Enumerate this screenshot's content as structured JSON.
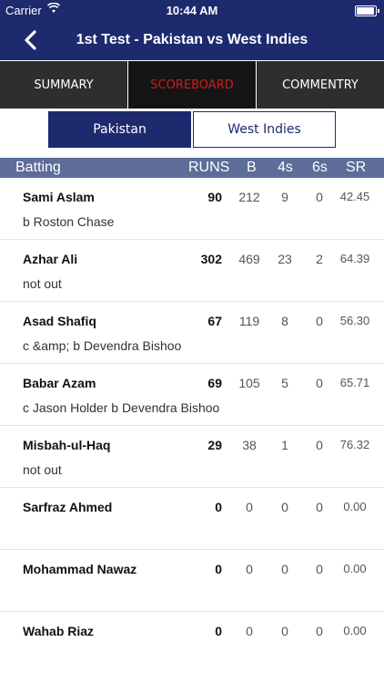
{
  "status_bar": {
    "carrier": "Carrier",
    "time": "10:44 AM",
    "wifi_icon": "wifi-icon",
    "battery_icon": "battery-icon"
  },
  "nav": {
    "title": "1st Test - Pakistan vs West Indies",
    "back_icon": "chevron-left-icon"
  },
  "tabs": [
    {
      "label": "SUMMARY",
      "active": false
    },
    {
      "label": "SCOREBOARD",
      "active": true
    },
    {
      "label": "COMMENTRY",
      "active": false
    }
  ],
  "teams": [
    {
      "label": "Pakistan",
      "active": true
    },
    {
      "label": "West Indies",
      "active": false
    }
  ],
  "table_header": {
    "batting": "Batting",
    "runs": "RUNS",
    "balls": "B",
    "fours": "4s",
    "sixes": "6s",
    "sr": "SR"
  },
  "batsmen": [
    {
      "name": "Sami Aslam",
      "dismissal": "b Roston Chase",
      "runs": "90",
      "balls": "212",
      "fours": "9",
      "sixes": "0",
      "sr": "42.45"
    },
    {
      "name": "Azhar Ali",
      "dismissal": "not out",
      "runs": "302",
      "balls": "469",
      "fours": "23",
      "sixes": "2",
      "sr": "64.39"
    },
    {
      "name": "Asad Shafiq",
      "dismissal": "c &amp; b Devendra Bishoo",
      "runs": "67",
      "balls": "119",
      "fours": "8",
      "sixes": "0",
      "sr": "56.30"
    },
    {
      "name": "Babar Azam",
      "dismissal": "c Jason Holder b Devendra Bishoo",
      "runs": "69",
      "balls": "105",
      "fours": "5",
      "sixes": "0",
      "sr": "65.71"
    },
    {
      "name": "Misbah-ul-Haq",
      "dismissal": "not out",
      "runs": "29",
      "balls": "38",
      "fours": "1",
      "sixes": "0",
      "sr": "76.32"
    },
    {
      "name": "Sarfraz Ahmed",
      "dismissal": "",
      "runs": "0",
      "balls": "0",
      "fours": "0",
      "sixes": "0",
      "sr": "0.00"
    },
    {
      "name": "Mohammad Nawaz",
      "dismissal": "",
      "runs": "0",
      "balls": "0",
      "fours": "0",
      "sixes": "0",
      "sr": "0.00"
    },
    {
      "name": "Wahab Riaz",
      "dismissal": "",
      "runs": "0",
      "balls": "0",
      "fours": "0",
      "sixes": "0",
      "sr": "0.00"
    }
  ],
  "colors": {
    "navy": "#1e2a6e",
    "header_row": "#5d6c98",
    "active_tab_text": "#d01c1c"
  }
}
